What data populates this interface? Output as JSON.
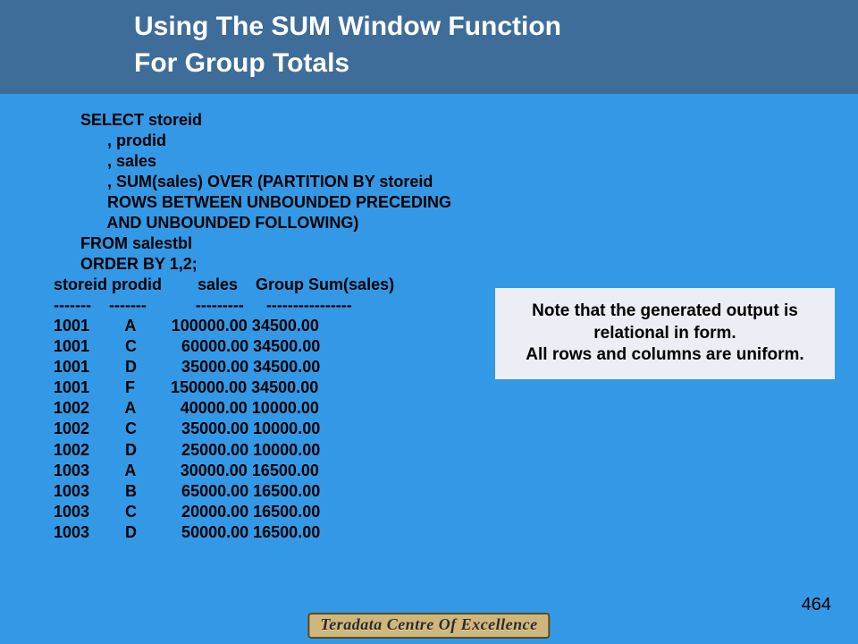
{
  "header": {
    "line1": "Using The SUM Window Function",
    "line2": "For Group Totals"
  },
  "sql": {
    "l1": "      SELECT storeid",
    "l2": "            , prodid",
    "l3": "            , sales",
    "l4": "            , SUM(sales) OVER (PARTITION BY storeid",
    "l5": "            ROWS BETWEEN UNBOUNDED PRECEDING",
    "l6": "            AND UNBOUNDED FOLLOWING)",
    "l7": "      FROM salestbl",
    "l8": "      ORDER BY 1,2;",
    "hdr": "storeid prodid        sales    Group Sum(sales)",
    "sep": "-------    -------           ---------     ----------------",
    "r1": "1001        A        100000.00 34500.00",
    "r2": "1001        C          60000.00 34500.00",
    "r3": "1001        D          35000.00 34500.00",
    "r4": "1001        F        150000.00 34500.00",
    "r5": "1002        A          40000.00 10000.00",
    "r6": "1002        C          35000.00 10000.00",
    "r7": "1002        D          25000.00 10000.00",
    "r8": "1003        A          30000.00 16500.00",
    "r9": "1003        B          65000.00 16500.00",
    "r10": "1003        C          20000.00 16500.00",
    "r11": "1003        D          50000.00 16500.00"
  },
  "note": {
    "line1": "Note that the generated output is relational in form.",
    "line2": "All rows and columns are uniform."
  },
  "page_number": "464",
  "footer": "Teradata Centre Of Excellence",
  "chart_data": {
    "type": "table",
    "title": "SUM(sales) OVER (PARTITION BY storeid) output",
    "columns": [
      "storeid",
      "prodid",
      "sales",
      "Group Sum(sales)"
    ],
    "rows": [
      [
        1001,
        "A",
        100000.0,
        34500.0
      ],
      [
        1001,
        "C",
        60000.0,
        34500.0
      ],
      [
        1001,
        "D",
        35000.0,
        34500.0
      ],
      [
        1001,
        "F",
        150000.0,
        34500.0
      ],
      [
        1002,
        "A",
        40000.0,
        10000.0
      ],
      [
        1002,
        "C",
        35000.0,
        10000.0
      ],
      [
        1002,
        "D",
        25000.0,
        10000.0
      ],
      [
        1003,
        "A",
        30000.0,
        16500.0
      ],
      [
        1003,
        "B",
        65000.0,
        16500.0
      ],
      [
        1003,
        "C",
        20000.0,
        16500.0
      ],
      [
        1003,
        "D",
        50000.0,
        16500.0
      ]
    ]
  }
}
